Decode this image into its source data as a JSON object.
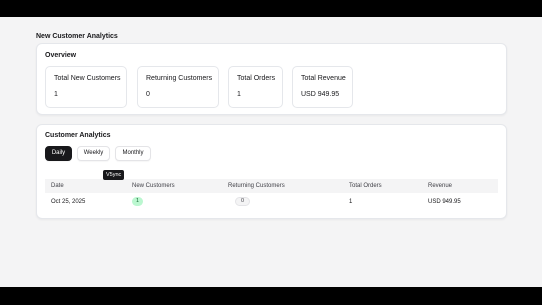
{
  "page": {
    "title": "New Customer Analytics"
  },
  "overview": {
    "title": "Overview",
    "stats": [
      {
        "label": "Total New Customers",
        "value": "1"
      },
      {
        "label": "Returning Customers",
        "value": "0"
      },
      {
        "label": "Total Orders",
        "value": "1"
      },
      {
        "label": "Total Revenue",
        "value": "USD 949.95"
      }
    ]
  },
  "analytics": {
    "title": "Customer Analytics",
    "tabs": [
      {
        "label": "Daily",
        "active": true
      },
      {
        "label": "Weekly",
        "active": false
      },
      {
        "label": "Monthly",
        "active": false
      }
    ],
    "tooltip": "V5ync",
    "table": {
      "headers": [
        "Date",
        "New Customers",
        "Returning Customers",
        "Total Orders",
        "Revenue"
      ],
      "rows": [
        {
          "date": "Oct 25, 2025",
          "new_customers": "1",
          "returning_customers": "0",
          "total_orders": "1",
          "revenue": "USD 949.95"
        }
      ]
    }
  },
  "colors": {
    "accent": "#18181b",
    "success_badge_bg": "#bbf7d0",
    "success_badge_text": "#166534",
    "page_bg": "#f4f4f5"
  }
}
